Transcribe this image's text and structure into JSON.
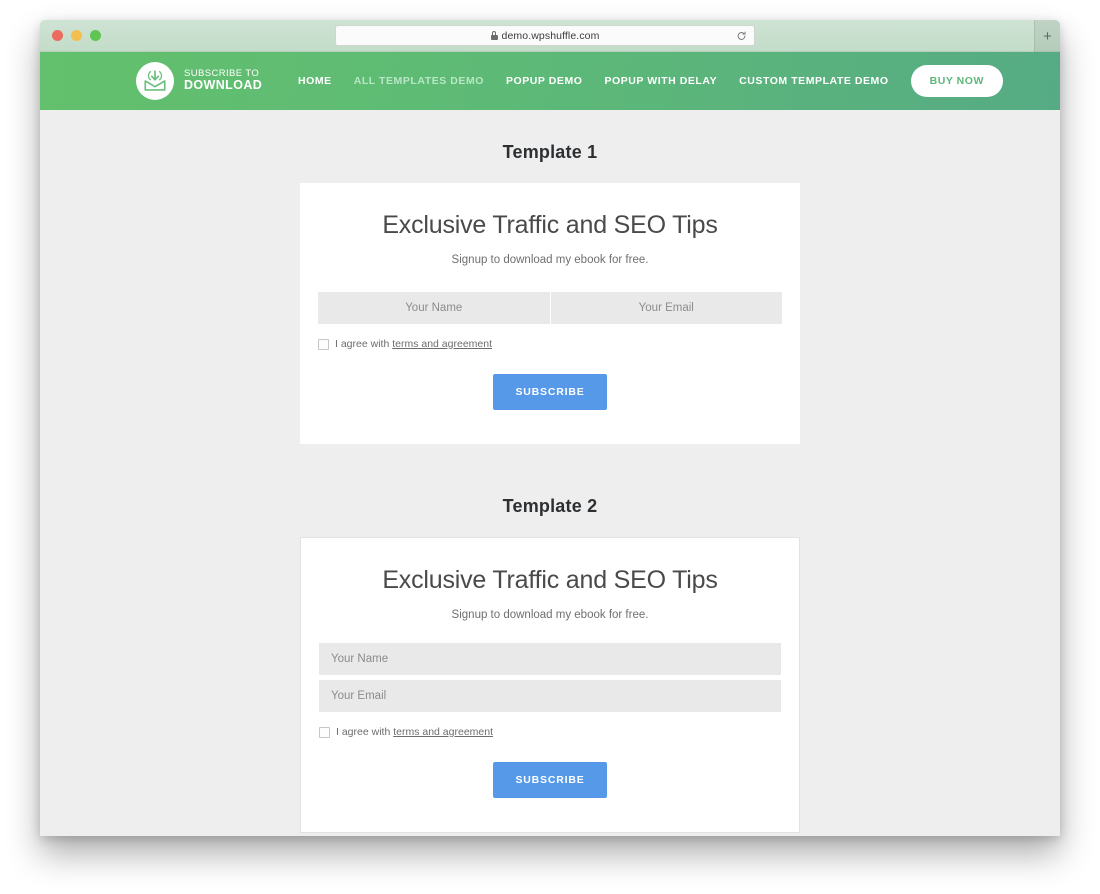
{
  "browser": {
    "url": "demo.wpshuffle.com",
    "lock_icon": "lock-icon",
    "reload_icon": "reload-icon",
    "new_tab_label": "+",
    "traffic_lights": [
      "close",
      "minimize",
      "maximize"
    ]
  },
  "header": {
    "brand": {
      "line1": "SUBSCRIBE TO",
      "line2": "DOWNLOAD",
      "logo_icon": "envelope-download-icon"
    },
    "nav": [
      {
        "label": "HOME",
        "active": false
      },
      {
        "label": "ALL TEMPLATES DEMO",
        "active": true
      },
      {
        "label": "POPUP DEMO",
        "active": false
      },
      {
        "label": "POPUP WITH DELAY",
        "active": false
      },
      {
        "label": "CUSTOM TEMPLATE DEMO",
        "active": false
      }
    ],
    "buy_now_label": "BUY NOW",
    "gradient_from": "#63c06c",
    "gradient_to": "#56ab84"
  },
  "templates": [
    {
      "section_title": "Template 1",
      "card_title": "Exclusive Traffic and SEO Tips",
      "card_subtitle": "Signup to download my ebook for free.",
      "name_placeholder": "Your Name",
      "email_placeholder": "Your Email",
      "name_value": "",
      "email_value": "",
      "agree_text": "I agree with ",
      "terms_label": "terms and agreement",
      "checkbox_checked": false,
      "subscribe_label": "SUBSCRIBE"
    },
    {
      "section_title": "Template 2",
      "card_title": "Exclusive Traffic and SEO Tips",
      "card_subtitle": "Signup to download my ebook for free.",
      "name_placeholder": "Your Name",
      "email_placeholder": "Your Email",
      "name_value": "",
      "email_value": "",
      "agree_text": "I agree with ",
      "terms_label": "terms and agreement",
      "checkbox_checked": false,
      "subscribe_label": "SUBSCRIBE"
    }
  ],
  "colors": {
    "accent_button": "#5599e8",
    "page_background": "#eeeeee",
    "card_background": "#ffffff",
    "field_background": "#e9e9e9"
  }
}
